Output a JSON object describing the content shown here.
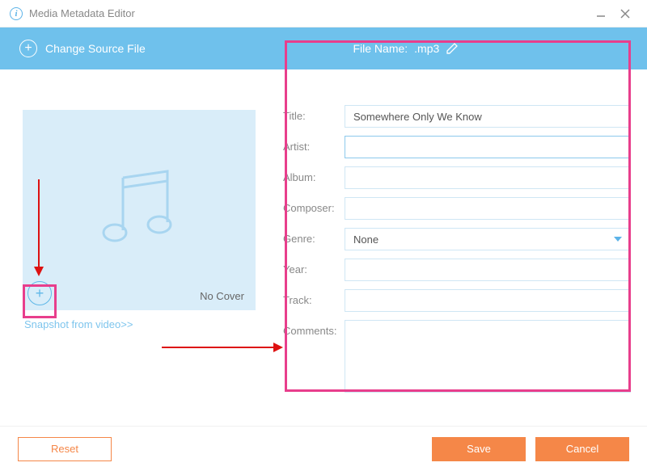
{
  "titlebar": {
    "title": "Media Metadata Editor"
  },
  "toolbar": {
    "change_source": "Change Source File",
    "filename_label": "File Name:",
    "filename_value": ".mp3"
  },
  "cover": {
    "no_cover": "No Cover",
    "snapshot_link": "Snapshot from video>>"
  },
  "form": {
    "labels": {
      "title": "Title:",
      "artist": "Artist:",
      "album": "Album:",
      "composer": "Composer:",
      "genre": "Genre:",
      "year": "Year:",
      "track": "Track:",
      "comments": "Comments:"
    },
    "values": {
      "title": "Somewhere Only We Know",
      "artist": "",
      "album": "",
      "composer": "",
      "genre": "None",
      "year": "",
      "track": "",
      "comments": ""
    }
  },
  "footer": {
    "reset": "Reset",
    "save": "Save",
    "cancel": "Cancel"
  }
}
